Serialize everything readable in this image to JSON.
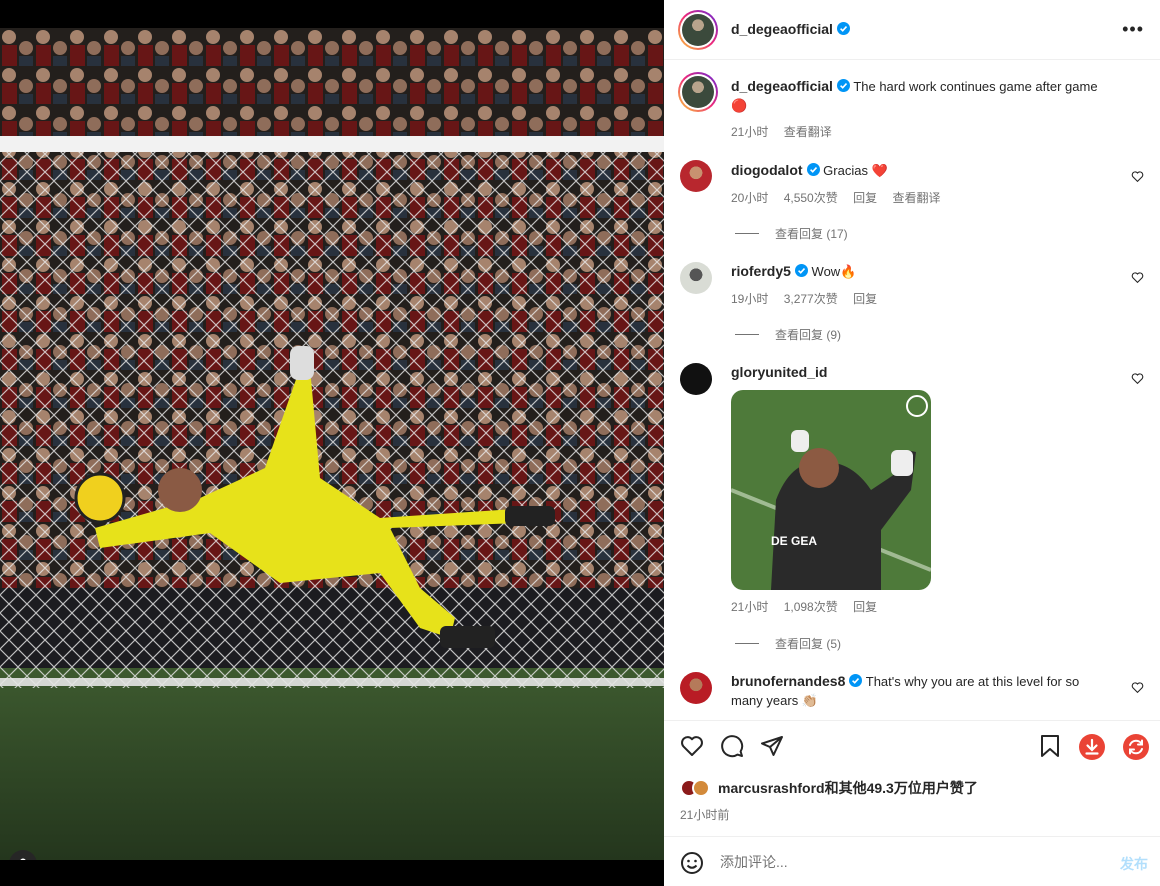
{
  "post": {
    "username": "d_degeaofficial",
    "caption": "The hard work continues game after game",
    "caption_emoji": "🔴",
    "caption_time": "21小时",
    "see_translation": "查看翻译"
  },
  "comments": [
    {
      "username": "diogodalot",
      "text": "Gracias",
      "emoji": "❤️",
      "time": "20小时",
      "likes": "4,550次赞",
      "reply": "回复",
      "translate": "查看翻译",
      "view_replies": "查看回复 (17)"
    },
    {
      "username": "rioferdy5",
      "text": "Wow",
      "emoji": "🔥",
      "time": "19小时",
      "likes": "3,277次赞",
      "reply": "回复",
      "view_replies": "查看回复 (9)"
    },
    {
      "username": "gloryunited_id",
      "media_text": "DE GEA",
      "time": "21小时",
      "likes": "1,098次赞",
      "reply": "回复",
      "view_replies": "查看回复 (5)"
    },
    {
      "username": "brunofernandes8",
      "text": "That's why you are at this level for so many years",
      "emoji": "👏🏼"
    }
  ],
  "footer": {
    "liked_by": "marcusrashford和其他49.3万位用户赞了",
    "time_ago": "21小时前",
    "comment_placeholder": "添加评论...",
    "post_label": "发布"
  },
  "colors": {
    "verified": "#0095f6",
    "heart_red": "#ed4956",
    "post_disabled": "#b2dffc",
    "download": "#ea4335"
  },
  "icons": [
    "more-icon",
    "heart-icon",
    "comment-icon",
    "share-icon",
    "bookmark-icon",
    "download-icon",
    "refresh-icon",
    "emoji-icon",
    "user-tag-icon",
    "verified-icon"
  ]
}
